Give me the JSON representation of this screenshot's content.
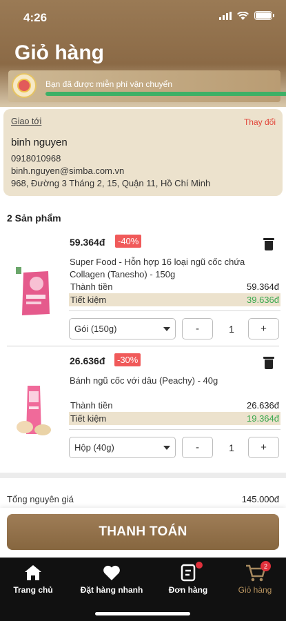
{
  "status_bar": {
    "time": "4:26"
  },
  "header": {
    "title": "Giỏ hàng"
  },
  "shipping_banner": {
    "text": "Bạn đã được miễn phí vận chuyển",
    "progress_fraction": 1.0
  },
  "address": {
    "label": "Giao tới",
    "change_label": "Thay đổi",
    "name": "binh nguyen",
    "phone": "0918010968",
    "email": "binh.nguyen@simba.com.vn",
    "street": "968, Đường 3 Tháng 2, 15, Quận 11, Hồ Chí Minh"
  },
  "cart": {
    "count_label": "2 Sản phẩm",
    "items": [
      {
        "price": "59.364đ",
        "discount": "-40%",
        "name": "Super Food - Hỗn hợp 16 loại ngũ cốc chứa Collagen (Tanesho) - 150g",
        "total_label": "Thành tiền",
        "total_value": "59.364đ",
        "save_label": "Tiết kiệm",
        "save_value": "39.636đ",
        "variant": "Gói (150g)",
        "minus": "-",
        "qty": "1",
        "plus": "+"
      },
      {
        "price": "26.636đ",
        "discount": "-30%",
        "name": "Bánh ngũ cốc với dâu (Peachy) - 40g",
        "total_label": "Thành tiền",
        "total_value": "26.636đ",
        "save_label": "Tiết kiệm",
        "save_value": "19.364đ",
        "variant": "Hộp (40g)",
        "minus": "-",
        "qty": "1",
        "plus": "+"
      }
    ]
  },
  "summary": {
    "original_label": "Tổng nguyên giá",
    "original_value": "145.000đ"
  },
  "checkout": {
    "label": "THANH TOÁN"
  },
  "tabbar": {
    "items": [
      {
        "label": "Trang chủ",
        "icon": "home-icon"
      },
      {
        "label": "Đặt hàng nhanh",
        "icon": "heart-icon"
      },
      {
        "label": "Đơn hàng",
        "icon": "order-icon"
      },
      {
        "label": "Giỏ hàng",
        "icon": "cart-icon",
        "badge": "2"
      }
    ]
  },
  "colors": {
    "accent": "#8b6a46",
    "discount": "#f05a5a",
    "savings": "#3aa84e",
    "badge": "#e0303b"
  }
}
